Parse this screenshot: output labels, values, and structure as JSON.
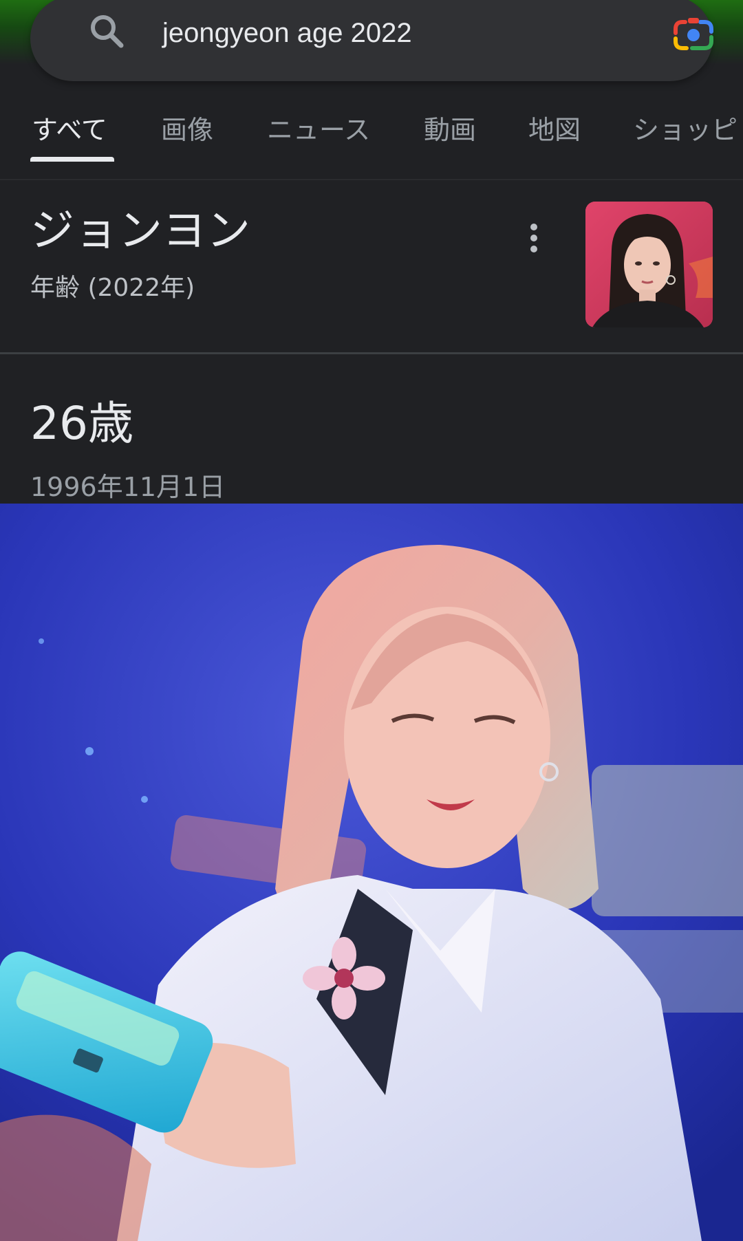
{
  "search": {
    "query": "jeongyeon age 2022",
    "icons": [
      "search-icon",
      "google-lens-icon"
    ]
  },
  "tabs": [
    {
      "label": "すべて",
      "active": true
    },
    {
      "label": "画像",
      "active": false
    },
    {
      "label": "ニュース",
      "active": false
    },
    {
      "label": "動画",
      "active": false
    },
    {
      "label": "地図",
      "active": false
    },
    {
      "label": "ショッピ",
      "active": false
    }
  ],
  "entity": {
    "name": "ジョンヨン",
    "subtitle": "年齢 (2022年)",
    "menu_icon": "more-vert-icon"
  },
  "answer": {
    "age": "26歳",
    "birthdate": "1996年11月1日"
  },
  "colors": {
    "background": "#202124",
    "search_bar": "#303134",
    "text_primary": "#e8eaed",
    "text_secondary": "#9aa0a6",
    "thumbnail_bg": "#d63c5e",
    "top_strip": "#1f6d12"
  }
}
